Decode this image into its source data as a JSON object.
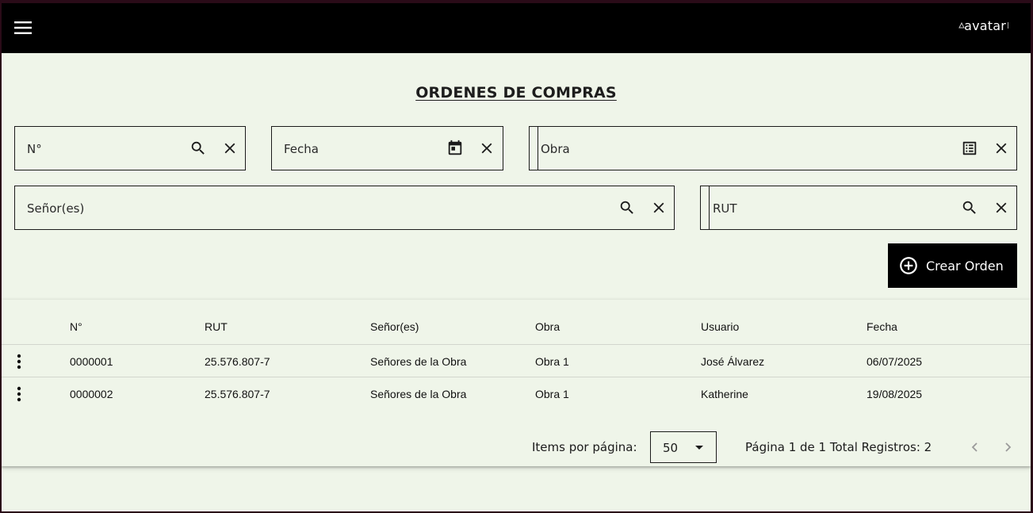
{
  "header": {
    "menu_icon": "hamburger-menu-icon",
    "avatar_alt": "avatar"
  },
  "page": {
    "title": "ORDENES DE COMPRAS"
  },
  "filters": {
    "numero": {
      "placeholder": "N°",
      "icons": [
        "search-icon",
        "close-icon"
      ]
    },
    "fecha": {
      "placeholder": "Fecha",
      "icons": [
        "calendar-icon",
        "close-icon"
      ]
    },
    "obra": {
      "placeholder": "Obra",
      "icons": [
        "list-icon",
        "close-icon"
      ]
    },
    "senores": {
      "placeholder": "Señor(es)",
      "icons": [
        "search-icon",
        "close-icon"
      ]
    },
    "rut": {
      "placeholder": "RUT",
      "icons": [
        "search-icon",
        "close-icon"
      ]
    }
  },
  "actions": {
    "crear_label": "Crear Orden"
  },
  "table": {
    "columns": [
      "N°",
      "RUT",
      "Señor(es)",
      "Obra",
      "Usuario",
      "Fecha"
    ],
    "rows": [
      [
        "0000001",
        "25.576.807-7",
        "Señores de la Obra",
        "Obra 1",
        "José Álvarez",
        "06/07/2025"
      ],
      [
        "0000002",
        "25.576.807-7",
        "Señores de la Obra",
        "Obra 1",
        "Katherine",
        "19/08/2025"
      ]
    ]
  },
  "paginator": {
    "items_label": "Items por página:",
    "page_size": "50",
    "range_label": "Página 1 de 1 Total Registros: 2"
  },
  "colors": {
    "background": "#eff5e9",
    "topbar": "#000000",
    "button": "#000000",
    "border": "#1b1b1b"
  }
}
